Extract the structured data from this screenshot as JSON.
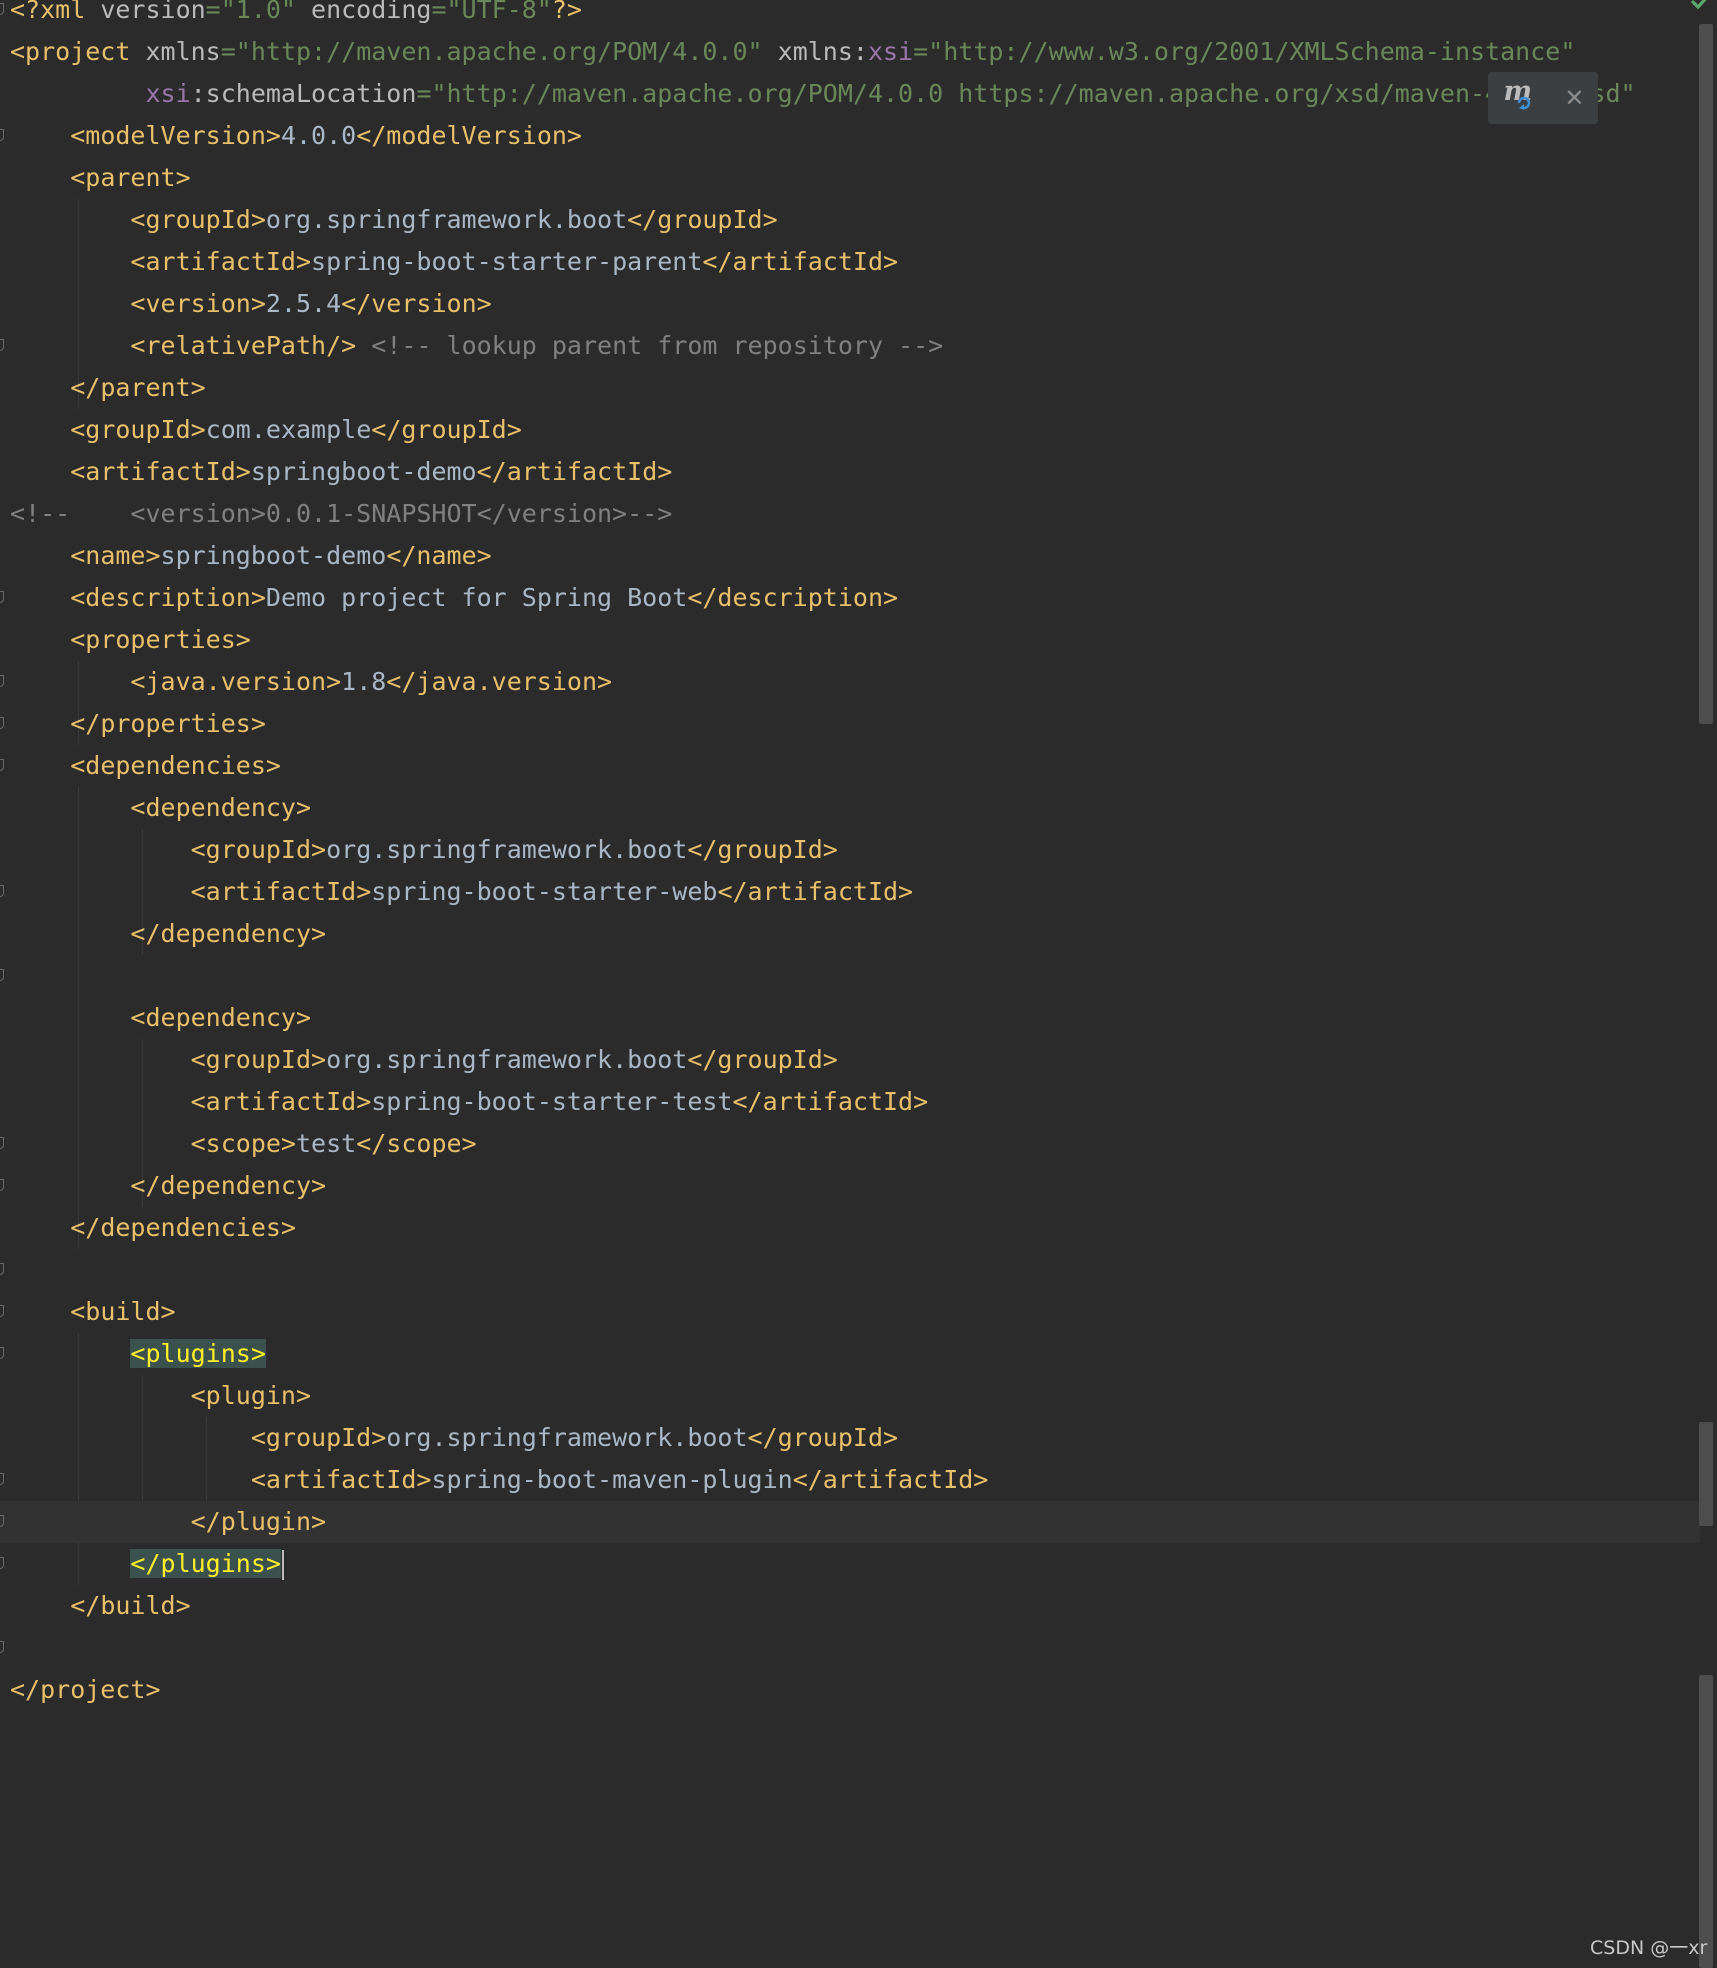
{
  "editor": {
    "file_type": "xml",
    "lines": [
      [
        {
          "c": "decl",
          "t": "<?xml "
        },
        {
          "c": "attr",
          "t": "version"
        },
        {
          "c": "val",
          "t": "=\"1.0\" "
        },
        {
          "c": "attr",
          "t": "encoding"
        },
        {
          "c": "val",
          "t": "=\"UTF-8\""
        },
        {
          "c": "decl",
          "t": "?>"
        }
      ],
      [
        {
          "c": "tag",
          "t": "<project "
        },
        {
          "c": "attr",
          "t": "xmlns"
        },
        {
          "c": "val",
          "t": "=\"http://maven.apache.org/POM/4.0.0\" "
        },
        {
          "c": "attr",
          "t": "xmlns:"
        },
        {
          "c": "ns",
          "t": "xsi"
        },
        {
          "c": "val",
          "t": "=\"http://www.w3.org/2001/XMLSchema-instance\""
        }
      ],
      [
        {
          "c": "text",
          "t": "         "
        },
        {
          "c": "ns",
          "t": "xsi"
        },
        {
          "c": "attr",
          "t": ":schemaLocation"
        },
        {
          "c": "val",
          "t": "=\"http://maven.apache.org/POM/4.0.0 https://maven.apache.org/xsd/maven-4.0.0.xsd\""
        }
      ],
      [
        {
          "c": "text",
          "t": "    "
        },
        {
          "c": "tag",
          "t": "<modelVersion>"
        },
        {
          "c": "text",
          "t": "4.0.0"
        },
        {
          "c": "tag",
          "t": "</modelVersion>"
        }
      ],
      [
        {
          "c": "text",
          "t": "    "
        },
        {
          "c": "tag",
          "t": "<parent>"
        }
      ],
      [
        {
          "c": "text",
          "t": "        "
        },
        {
          "c": "tag",
          "t": "<groupId>"
        },
        {
          "c": "text",
          "t": "org.springframework.boot"
        },
        {
          "c": "tag",
          "t": "</groupId>"
        }
      ],
      [
        {
          "c": "text",
          "t": "        "
        },
        {
          "c": "tag",
          "t": "<artifactId>"
        },
        {
          "c": "text",
          "t": "spring-boot-starter-parent"
        },
        {
          "c": "tag",
          "t": "</artifactId>"
        }
      ],
      [
        {
          "c": "text",
          "t": "        "
        },
        {
          "c": "tag",
          "t": "<version>"
        },
        {
          "c": "text",
          "t": "2.5.4"
        },
        {
          "c": "tag",
          "t": "</version>"
        }
      ],
      [
        {
          "c": "text",
          "t": "        "
        },
        {
          "c": "tag",
          "t": "<relativePath/>"
        },
        {
          "c": "text",
          "t": " "
        },
        {
          "c": "comment",
          "t": "<!-- lookup parent from repository -->"
        }
      ],
      [
        {
          "c": "text",
          "t": "    "
        },
        {
          "c": "tag",
          "t": "</parent>"
        }
      ],
      [
        {
          "c": "text",
          "t": "    "
        },
        {
          "c": "tag",
          "t": "<groupId>"
        },
        {
          "c": "text",
          "t": "com.example"
        },
        {
          "c": "tag",
          "t": "</groupId>"
        }
      ],
      [
        {
          "c": "text",
          "t": "    "
        },
        {
          "c": "tag",
          "t": "<artifactId>"
        },
        {
          "c": "text",
          "t": "springboot-demo"
        },
        {
          "c": "tag",
          "t": "</artifactId>"
        }
      ],
      [
        {
          "c": "comment",
          "t": "<!--    <version>0.0.1-SNAPSHOT</version>-->"
        }
      ],
      [
        {
          "c": "text",
          "t": "    "
        },
        {
          "c": "tag",
          "t": "<name>"
        },
        {
          "c": "text",
          "t": "springboot-demo"
        },
        {
          "c": "tag",
          "t": "</name>"
        }
      ],
      [
        {
          "c": "text",
          "t": "    "
        },
        {
          "c": "tag",
          "t": "<description>"
        },
        {
          "c": "text",
          "t": "Demo project for Spring Boot"
        },
        {
          "c": "tag",
          "t": "</description>"
        }
      ],
      [
        {
          "c": "text",
          "t": "    "
        },
        {
          "c": "tag",
          "t": "<properties>"
        }
      ],
      [
        {
          "c": "text",
          "t": "        "
        },
        {
          "c": "tag",
          "t": "<java.version>"
        },
        {
          "c": "text",
          "t": "1.8"
        },
        {
          "c": "tag",
          "t": "</java.version>"
        }
      ],
      [
        {
          "c": "text",
          "t": "    "
        },
        {
          "c": "tag",
          "t": "</properties>"
        }
      ],
      [
        {
          "c": "text",
          "t": "    "
        },
        {
          "c": "tag",
          "t": "<dependencies>"
        }
      ],
      [
        {
          "c": "text",
          "t": "        "
        },
        {
          "c": "tag",
          "t": "<dependency>"
        }
      ],
      [
        {
          "c": "text",
          "t": "            "
        },
        {
          "c": "tag",
          "t": "<groupId>"
        },
        {
          "c": "text",
          "t": "org.springframework.boot"
        },
        {
          "c": "tag",
          "t": "</groupId>"
        }
      ],
      [
        {
          "c": "text",
          "t": "            "
        },
        {
          "c": "tag",
          "t": "<artifactId>"
        },
        {
          "c": "text",
          "t": "spring-boot-starter-web"
        },
        {
          "c": "tag",
          "t": "</artifactId>"
        }
      ],
      [
        {
          "c": "text",
          "t": "        "
        },
        {
          "c": "tag",
          "t": "</dependency>"
        }
      ],
      [],
      [
        {
          "c": "text",
          "t": "        "
        },
        {
          "c": "tag",
          "t": "<dependency>"
        }
      ],
      [
        {
          "c": "text",
          "t": "            "
        },
        {
          "c": "tag",
          "t": "<groupId>"
        },
        {
          "c": "text",
          "t": "org.springframework.boot"
        },
        {
          "c": "tag",
          "t": "</groupId>"
        }
      ],
      [
        {
          "c": "text",
          "t": "            "
        },
        {
          "c": "tag",
          "t": "<artifactId>"
        },
        {
          "c": "text",
          "t": "spring-boot-starter-test"
        },
        {
          "c": "tag",
          "t": "</artifactId>"
        }
      ],
      [
        {
          "c": "text",
          "t": "            "
        },
        {
          "c": "tag",
          "t": "<scope>"
        },
        {
          "c": "text",
          "t": "test"
        },
        {
          "c": "tag",
          "t": "</scope>"
        }
      ],
      [
        {
          "c": "text",
          "t": "        "
        },
        {
          "c": "tag",
          "t": "</dependency>"
        }
      ],
      [
        {
          "c": "text",
          "t": "    "
        },
        {
          "c": "tag",
          "t": "</dependencies>"
        }
      ],
      [],
      [
        {
          "c": "text",
          "t": "    "
        },
        {
          "c": "tag",
          "t": "<build>"
        }
      ],
      [
        {
          "c": "text",
          "t": "        "
        },
        {
          "c": "tag",
          "t": "<plugins>",
          "hl": true
        }
      ],
      [
        {
          "c": "text",
          "t": "            "
        },
        {
          "c": "tag",
          "t": "<plugin>"
        }
      ],
      [
        {
          "c": "text",
          "t": "                "
        },
        {
          "c": "tag",
          "t": "<groupId>"
        },
        {
          "c": "text",
          "t": "org.springframework.boot"
        },
        {
          "c": "tag",
          "t": "</groupId>"
        }
      ],
      [
        {
          "c": "text",
          "t": "                "
        },
        {
          "c": "tag",
          "t": "<artifactId>"
        },
        {
          "c": "text",
          "t": "spring-boot-maven-plugin"
        },
        {
          "c": "tag",
          "t": "</artifactId>"
        }
      ],
      [
        {
          "c": "text",
          "t": "            "
        },
        {
          "c": "tag",
          "t": "</plugin>"
        }
      ],
      [
        {
          "c": "text",
          "t": "        "
        },
        {
          "c": "tag",
          "t": "</plugins>",
          "hl": true,
          "caret": true
        }
      ],
      [
        {
          "c": "text",
          "t": "    "
        },
        {
          "c": "tag",
          "t": "</build>"
        }
      ],
      [],
      [
        {
          "c": "tag",
          "t": "</project>"
        }
      ]
    ],
    "fold_marker_lines": [
      1,
      4,
      9,
      15,
      17,
      18,
      19,
      22,
      24,
      28,
      29,
      31,
      32,
      33,
      36,
      37,
      38,
      40
    ],
    "caret_line": 37
  },
  "popup": {
    "icon": "maven-reload-icon",
    "close_label": "✕"
  },
  "status": {
    "icon": "inspection-ok-check-icon"
  },
  "watermark": "CSDN @一xr",
  "colors": {
    "background": "#2b2b2b",
    "tag": "#e8bf6a",
    "attribute": "#bababa",
    "namespace": "#9876aa",
    "string": "#6a8759",
    "text": "#a9b7c6",
    "comment": "#808080",
    "highlight_bg": "#3b514d",
    "highlight_fg": "#ffef28",
    "check": "#59a869"
  }
}
